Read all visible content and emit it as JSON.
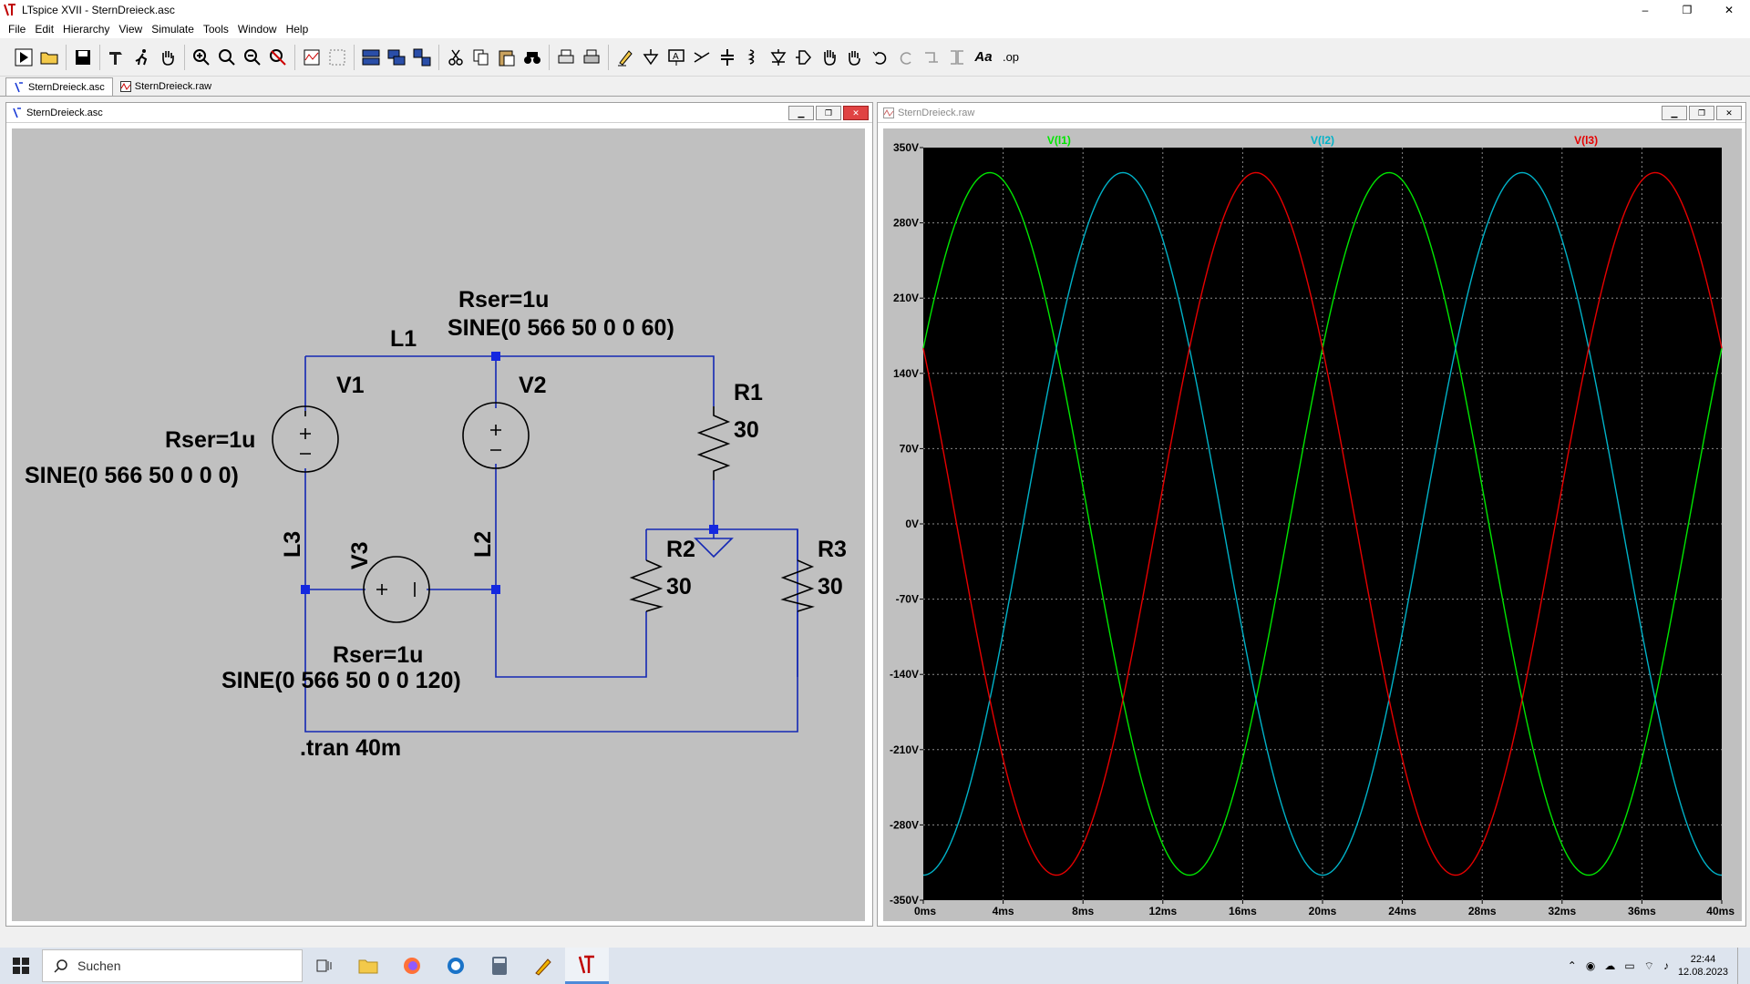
{
  "window": {
    "title": "LTspice XVII - SternDreieck.asc",
    "minimize": "–",
    "maximize": "❐",
    "close": "✕"
  },
  "menu": [
    {
      "label": "File"
    },
    {
      "label": "Edit"
    },
    {
      "label": "Hierarchy"
    },
    {
      "label": "View"
    },
    {
      "label": "Simulate"
    },
    {
      "label": "Tools"
    },
    {
      "label": "Window"
    },
    {
      "label": "Help"
    }
  ],
  "toolbar": {
    "text_tool": "Aa",
    "op_tool": ".op"
  },
  "tabs": [
    {
      "label": "SternDreieck.asc"
    },
    {
      "label": "SternDreieck.raw"
    }
  ],
  "schematic_window": {
    "title": "SternDreieck.asc",
    "labels": {
      "v2_rser": "Rser=1u",
      "v2_sine": "SINE(0 566 50 0 0 60)",
      "l1": "L1",
      "v1_name": "V1",
      "v2_name": "V2",
      "r1_name": "R1",
      "r1_value": "30",
      "v1_rser": "Rser=1u",
      "v1_sine": "SINE(0 566 50 0 0 0)",
      "l3": "L3",
      "v3_name": "V3",
      "l2": "L2",
      "r2_name": "R2",
      "r2_value": "30",
      "r3_name": "R3",
      "r3_value": "30",
      "v3_rser": "Rser=1u",
      "v3_sine": "SINE(0 566 50 0 0 120)",
      "tran": ".tran 40m"
    }
  },
  "waveform_window": {
    "title": "SternDreieck.raw"
  },
  "chart_data": {
    "type": "line",
    "x_unit": "ms",
    "xlim": [
      0,
      40
    ],
    "ylim": [
      -350,
      350
    ],
    "x_ticks": [
      "0ms",
      "4ms",
      "8ms",
      "12ms",
      "16ms",
      "20ms",
      "24ms",
      "28ms",
      "32ms",
      "36ms",
      "40ms"
    ],
    "y_ticks": [
      "350V",
      "280V",
      "210V",
      "140V",
      "70V",
      "0V",
      "-70V",
      "-140V",
      "-210V",
      "-280V",
      "-350V"
    ],
    "grid": true,
    "background": "#000000",
    "amplitude_v": 326.7,
    "frequency_hz": 50,
    "series": [
      {
        "name": "V(l1)",
        "color": "#00e600",
        "phase_deg": 30
      },
      {
        "name": "V(l2)",
        "color": "#00b2c8",
        "phase_deg": -90
      },
      {
        "name": "V(l3)",
        "color": "#e60000",
        "phase_deg": 150
      }
    ]
  },
  "taskbar": {
    "search_placeholder": "Suchen",
    "time": "22:44",
    "date": "12.08.2023"
  }
}
